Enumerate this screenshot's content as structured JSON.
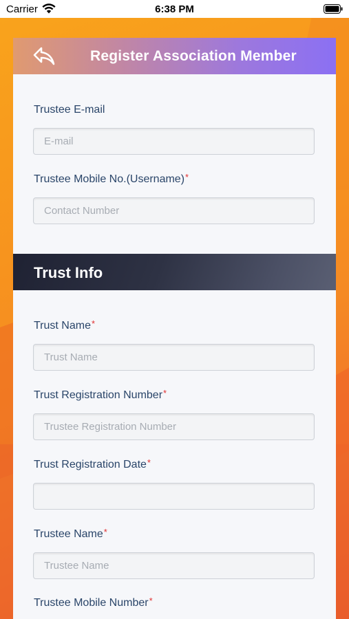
{
  "status_bar": {
    "carrier": "Carrier",
    "time": "6:38 PM",
    "icons": [
      "wifi-icon",
      "battery-icon"
    ]
  },
  "header": {
    "title": "Register Association Member",
    "back_icon": "back-arrow-icon",
    "gradient_colors": [
      "#e09a70",
      "#8b70f3"
    ]
  },
  "trustee_email": {
    "label": "Trustee E-mail",
    "value": "",
    "placeholder": "E-mail"
  },
  "trustee_mobile_username": {
    "label": "Trustee Mobile No.(Username)",
    "required_mark": "*",
    "value": "",
    "placeholder": "Contact Number"
  },
  "section": {
    "title": "Trust Info"
  },
  "trust_name": {
    "label": "Trust Name",
    "required_mark": "*",
    "value": "",
    "placeholder": "Trust Name"
  },
  "trust_registration_number": {
    "label": "Trust Registration Number",
    "required_mark": "*",
    "value": "",
    "placeholder": "Trustee Registration Number"
  },
  "trust_registration_date": {
    "label": "Trust Registration Date",
    "required_mark": "*",
    "value": "",
    "placeholder": ""
  },
  "trustee_name": {
    "label": "Trustee Name",
    "required_mark": "*",
    "value": "",
    "placeholder": "Trustee Name"
  },
  "trustee_mobile_number": {
    "label": "Trustee Mobile Number",
    "required_mark": "*"
  },
  "colors": {
    "label_text": "#2a4569",
    "required": "#e03131",
    "background_orange": "#f7931e",
    "section_dark": "#1f2233"
  }
}
